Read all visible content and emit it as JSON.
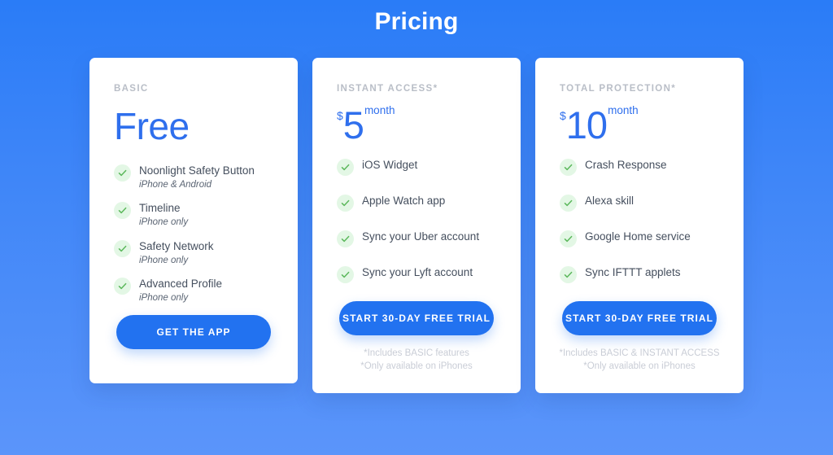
{
  "header": {
    "title": "Pricing"
  },
  "theme": {
    "bg_gradient_top": "#2a7cf7",
    "bg_gradient_bottom": "#5b95fa",
    "accent_blue": "#2272f0",
    "price_blue": "#2f6fed",
    "label_gray": "#b9bec7",
    "feature_text": "#454f5e",
    "check_green": "#5cb85c",
    "check_bg": "#e3f7e5",
    "card_bg": "#ffffff"
  },
  "plans": [
    {
      "id": "basic",
      "label": "BASIC",
      "price_free_text": "Free",
      "currency": "",
      "amount": "",
      "period": "",
      "features": [
        {
          "name": "Noonlight Safety Button",
          "sub": "iPhone & Android"
        },
        {
          "name": "Timeline",
          "sub": "iPhone only"
        },
        {
          "name": "Safety Network",
          "sub": "iPhone only"
        },
        {
          "name": "Advanced Profile",
          "sub": "iPhone only"
        }
      ],
      "cta_label": "GET THE APP",
      "disclaimer": []
    },
    {
      "id": "instant-access",
      "label": "INSTANT ACCESS*",
      "price_free_text": "",
      "currency": "$",
      "amount": "5",
      "period": "month",
      "features": [
        {
          "name": "iOS Widget",
          "sub": ""
        },
        {
          "name": "Apple Watch app",
          "sub": ""
        },
        {
          "name": "Sync your Uber account",
          "sub": ""
        },
        {
          "name": "Sync your Lyft account",
          "sub": ""
        }
      ],
      "cta_label": "START 30-DAY FREE TRIAL",
      "disclaimer": [
        "*Includes BASIC features",
        "*Only available on iPhones"
      ]
    },
    {
      "id": "total-protection",
      "label": "TOTAL PROTECTION*",
      "price_free_text": "",
      "currency": "$",
      "amount": "10",
      "period": "month",
      "features": [
        {
          "name": "Crash Response",
          "sub": ""
        },
        {
          "name": "Alexa skill",
          "sub": ""
        },
        {
          "name": "Google Home service",
          "sub": ""
        },
        {
          "name": "Sync IFTTT applets",
          "sub": ""
        }
      ],
      "cta_label": "START 30-DAY FREE TRIAL",
      "disclaimer": [
        "*Includes BASIC & INSTANT ACCESS",
        "*Only available on iPhones"
      ]
    }
  ]
}
